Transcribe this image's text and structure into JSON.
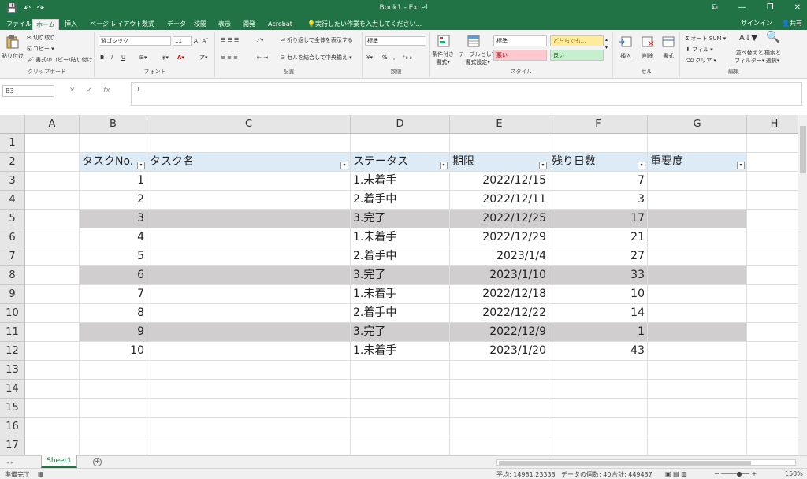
{
  "window": {
    "title": "Book1 - Excel",
    "qat_save": "💾",
    "qat_undo": "↶",
    "qat_redo": "↷",
    "restore_icon": "⧉",
    "minimize": "—",
    "maximize": "❐",
    "close": "✕"
  },
  "tabs": [
    "ファイル",
    "ホーム",
    "挿入",
    "ページ レイアウト",
    "数式",
    "データ",
    "校閲",
    "表示",
    "開発",
    "Acrobat"
  ],
  "tell_me": "実行したい作業を入力してください...",
  "signin": "サインイン",
  "share": "共有",
  "ribbon": {
    "clipboard": {
      "paste": "貼り付け",
      "cut": "切り取り",
      "copy": "コピー",
      "format_painter": "書式のコピー/貼り付け",
      "label": "クリップボード"
    },
    "font": {
      "name": "游ゴシック",
      "size": "11",
      "bold": "B",
      "italic": "I",
      "underline": "U",
      "label": "フォント"
    },
    "alignment": {
      "wrap": "折り返して全体を表示する",
      "merge": "セルを結合して中央揃え",
      "label": "配置"
    },
    "number": {
      "format": "標準",
      "percent": "%",
      "comma": ",",
      "label": "数値"
    },
    "styles": {
      "conditional": "条件付き",
      "conditional2": "書式",
      "table": "テーブルとして",
      "table2": "書式設定",
      "normal": "標準",
      "neutral": "どちらでも...",
      "bad": "悪い",
      "good": "良い",
      "label": "スタイル"
    },
    "cells": {
      "insert": "挿入",
      "delete": "削除",
      "format": "書式",
      "label": "セル"
    },
    "editing": {
      "autosum": "オート SUM",
      "fill": "フィル",
      "clear": "クリア",
      "sort": "並べ替えと",
      "sort2": "フィルター",
      "find": "検索と",
      "find2": "選択",
      "label": "編集"
    }
  },
  "formula_bar": {
    "name_box": "B3",
    "value": "1",
    "cancel": "✕",
    "enter": "✓",
    "fx": "fx"
  },
  "columns": [
    "A",
    "B",
    "C",
    "D",
    "E",
    "F",
    "G",
    "H"
  ],
  "rows": [
    "1",
    "2",
    "3",
    "4",
    "5",
    "6",
    "7",
    "8",
    "9",
    "10",
    "11",
    "12",
    "13",
    "14",
    "15",
    "16",
    "17"
  ],
  "table": {
    "headers": [
      "タスクNo.",
      "タスク名",
      "ステータス",
      "期限",
      "残り日数",
      "重要度"
    ],
    "filter_icon": "▾",
    "rows": [
      {
        "no": "1",
        "name": "",
        "status": "1.未着手",
        "due": "2022/12/15",
        "remain": "7",
        "priority": ""
      },
      {
        "no": "2",
        "name": "",
        "status": "2.着手中",
        "due": "2022/12/11",
        "remain": "3",
        "priority": ""
      },
      {
        "no": "3",
        "name": "",
        "status": "3.完了",
        "due": "2022/12/25",
        "remain": "17",
        "priority": ""
      },
      {
        "no": "4",
        "name": "",
        "status": "1.未着手",
        "due": "2022/12/29",
        "remain": "21",
        "priority": ""
      },
      {
        "no": "5",
        "name": "",
        "status": "2.着手中",
        "due": "2023/1/4",
        "remain": "27",
        "priority": ""
      },
      {
        "no": "6",
        "name": "",
        "status": "3.完了",
        "due": "2023/1/10",
        "remain": "33",
        "priority": ""
      },
      {
        "no": "7",
        "name": "",
        "status": "1.未着手",
        "due": "2022/12/18",
        "remain": "10",
        "priority": ""
      },
      {
        "no": "8",
        "name": "",
        "status": "2.着手中",
        "due": "2022/12/22",
        "remain": "14",
        "priority": ""
      },
      {
        "no": "9",
        "name": "",
        "status": "3.完了",
        "due": "2022/12/9",
        "remain": "1",
        "priority": ""
      },
      {
        "no": "10",
        "name": "",
        "status": "1.未着手",
        "due": "2023/1/20",
        "remain": "43",
        "priority": ""
      }
    ]
  },
  "sheet_tab": "Sheet1",
  "add_sheet": "+",
  "status": {
    "ready": "準備完了",
    "average": "平均: 14981.23333",
    "count": "データの個数: 40",
    "sum": "合計: 449437",
    "zoom": "150%"
  },
  "colors": {
    "accent": "#217346",
    "header_fill": "#ddebf7",
    "done_fill": "#d0cece"
  }
}
